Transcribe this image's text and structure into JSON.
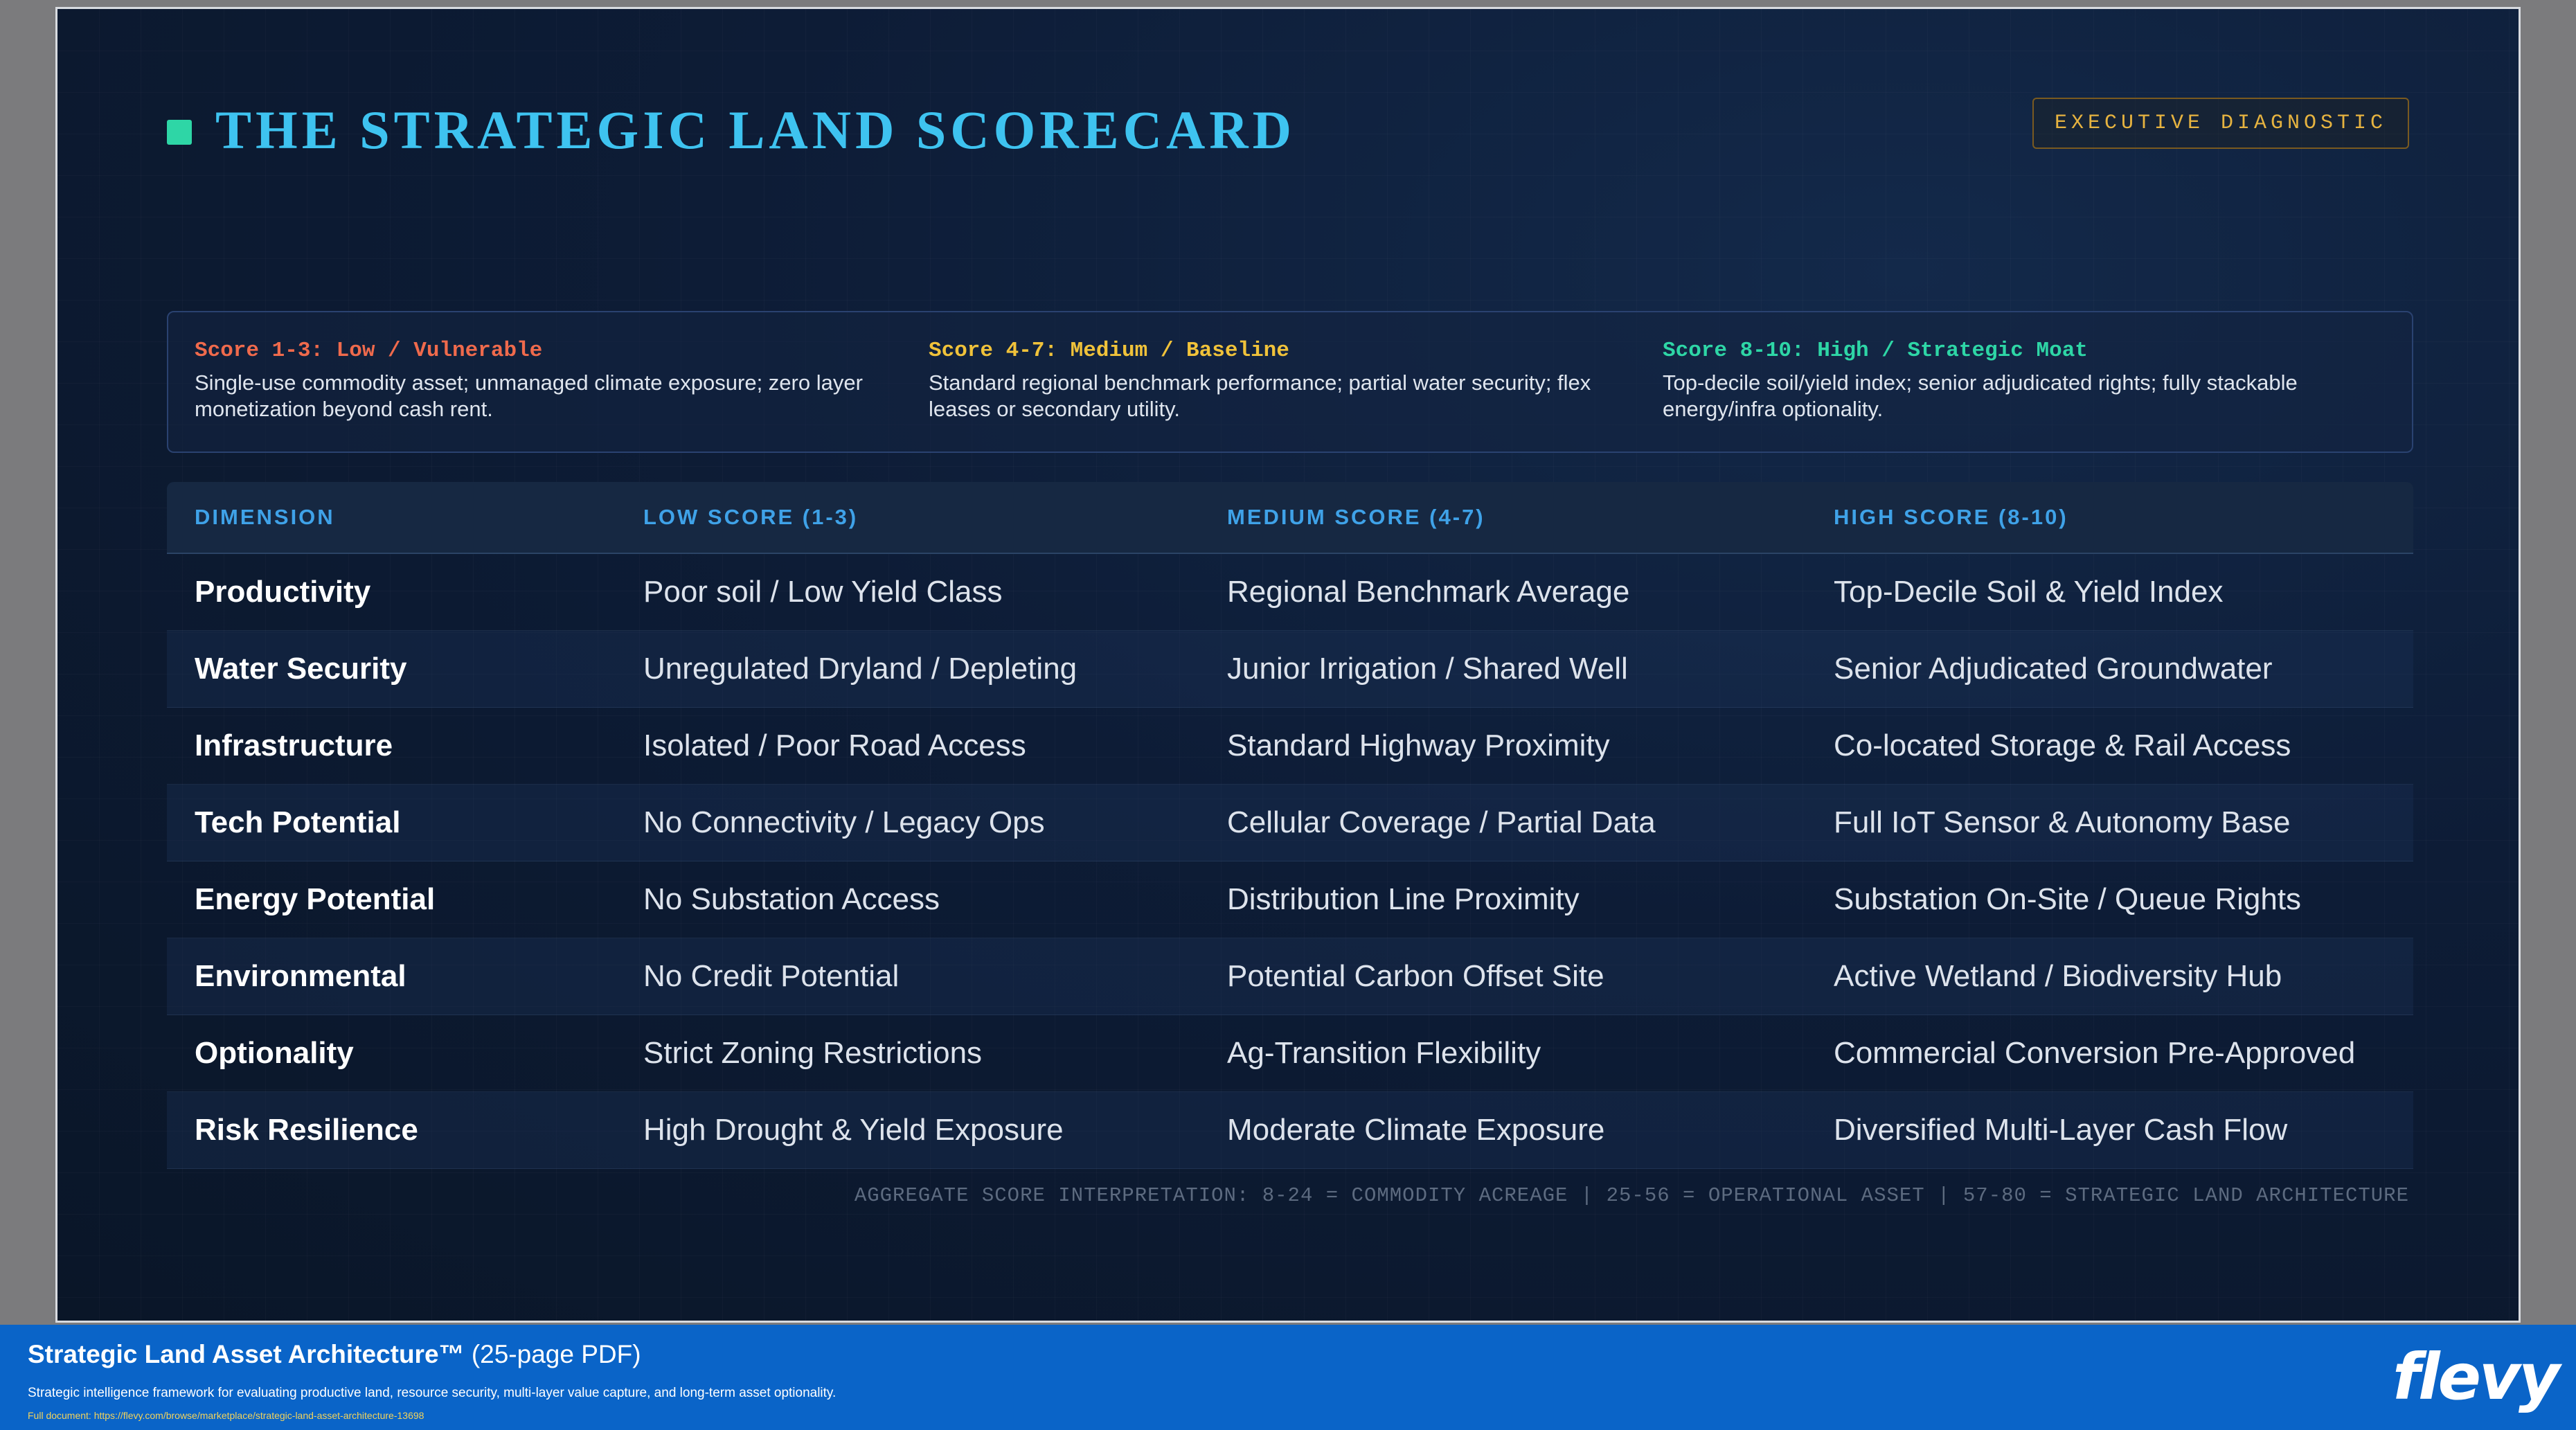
{
  "slide": {
    "title": "THE STRATEGIC LAND SCORECARD",
    "badge": "EXECUTIVE DIAGNOSTIC",
    "accent_color": "#2ed6a6",
    "title_color": "#3ec3f0"
  },
  "legend": [
    {
      "heading": "Score 1-3: Low / Vulnerable",
      "color": "#ef6a4c",
      "description": "Single-use commodity asset; unmanaged climate exposure; zero layer monetization beyond cash rent."
    },
    {
      "heading": "Score 4-7: Medium / Baseline",
      "color": "#f0c23a",
      "description": "Standard regional benchmark performance; partial water security; flex leases or secondary utility."
    },
    {
      "heading": "Score 8-10: High / Strategic Moat",
      "color": "#2ed6a6",
      "description": "Top-decile soil/yield index; senior adjudicated rights; fully stackable energy/infra optionality."
    }
  ],
  "table": {
    "headers": [
      "DIMENSION",
      "LOW SCORE (1-3)",
      "MEDIUM SCORE (4-7)",
      "HIGH SCORE (8-10)"
    ],
    "rows": [
      [
        "Productivity",
        "Poor soil / Low Yield Class",
        "Regional Benchmark Average",
        "Top-Decile Soil & Yield Index"
      ],
      [
        "Water Security",
        "Unregulated Dryland / Depleting",
        "Junior Irrigation / Shared Well",
        "Senior Adjudicated Groundwater"
      ],
      [
        "Infrastructure",
        "Isolated / Poor Road Access",
        "Standard Highway Proximity",
        "Co-located Storage & Rail Access"
      ],
      [
        "Tech Potential",
        "No Connectivity / Legacy Ops",
        "Cellular Coverage / Partial Data",
        "Full IoT Sensor & Autonomy Base"
      ],
      [
        "Energy Potential",
        "No Substation Access",
        "Distribution Line Proximity",
        "Substation On-Site / Queue Rights"
      ],
      [
        "Environmental",
        "No Credit Potential",
        "Potential Carbon Offset Site",
        "Active Wetland / Biodiversity Hub"
      ],
      [
        "Optionality",
        "Strict Zoning Restrictions",
        "Ag-Transition Flexibility",
        "Commercial Conversion Pre-Approved"
      ],
      [
        "Risk Resilience",
        "High Drought & Yield Exposure",
        "Moderate Climate Exposure",
        "Diversified Multi-Layer Cash Flow"
      ]
    ]
  },
  "aggregate_note": "AGGREGATE SCORE INTERPRETATION: 8-24 = COMMODITY ACREAGE | 25-56 = OPERATIONAL ASSET | 57-80 = STRATEGIC LAND ARCHITECTURE",
  "footer": {
    "doc_name": "Strategic Land Asset Architecture™",
    "pages": " (25-page PDF)",
    "description": "Strategic intelligence framework for evaluating productive land, resource security, multi-layer value capture, and long-term asset optionality.",
    "link": "Full document: https://flevy.com/browse/marketplace/strategic-land-asset-architecture-13698",
    "logo": "flevy",
    "background_color": "#0a64c8"
  }
}
